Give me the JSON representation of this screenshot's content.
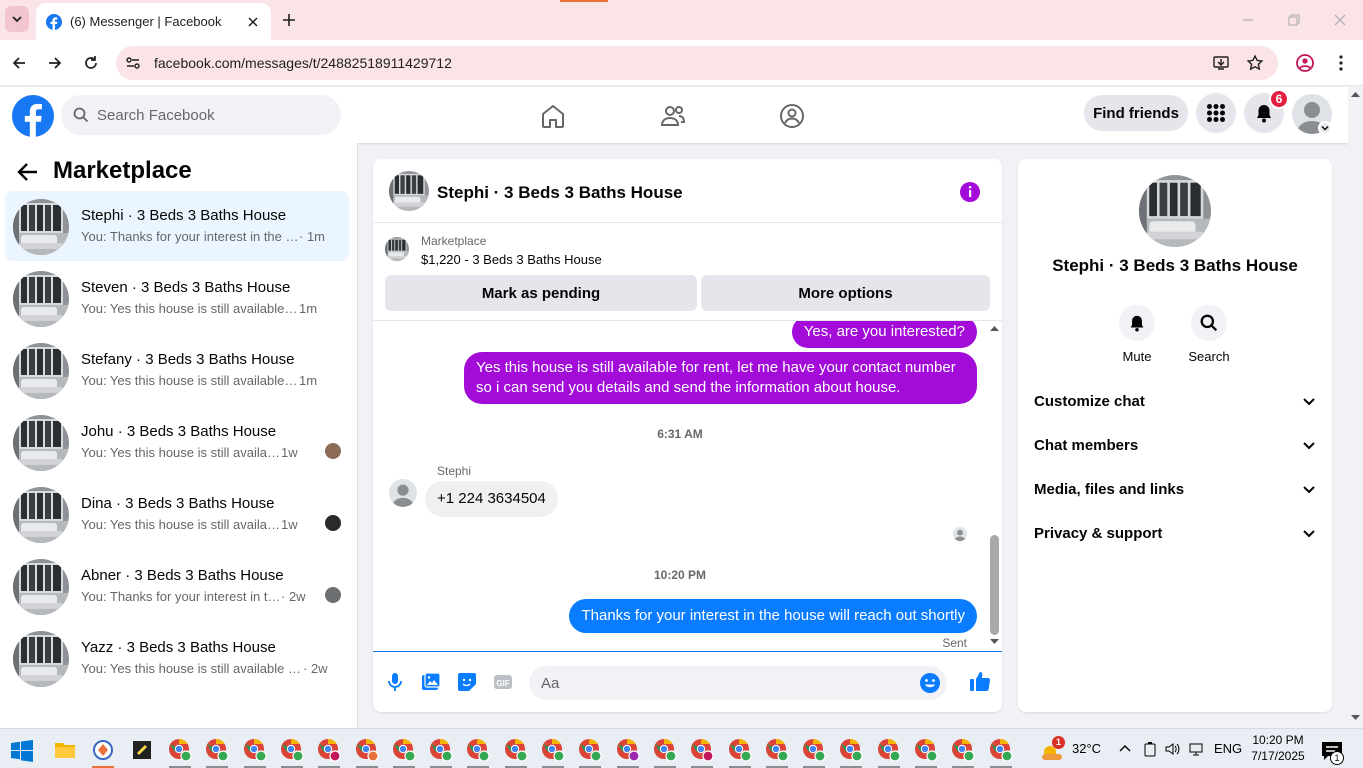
{
  "browser": {
    "tab_title": "(6) Messenger | Facebook",
    "url": "facebook.com/messages/t/24882518911429712"
  },
  "header": {
    "search_placeholder": "Search Facebook",
    "find_friends": "Find friends",
    "notif_count": "6"
  },
  "left": {
    "title": "Marketplace",
    "conversations": [
      {
        "name": "Stephi · 3 Beds 3 Baths House",
        "preview": "You: Thanks for your interest in the h...",
        "time": " · 1m",
        "active": true
      },
      {
        "name": "Steven · 3 Beds 3 Baths House",
        "preview": "You: Yes this house is still available fo...",
        "time": " 1m"
      },
      {
        "name": "Stefany · 3 Beds 3 Baths House",
        "preview": "You: Yes this house is still available fo...",
        "time": " 1m"
      },
      {
        "name": "Johu · 3 Beds 3 Baths House",
        "preview": "You: Yes this house is still available ...",
        "time": " 1w"
      },
      {
        "name": "Dina · 3 Beds 3 Baths House",
        "preview": "You: Yes this house is still available ...",
        "time": " 1w"
      },
      {
        "name": "Abner · 3 Beds 3 Baths House",
        "preview": "You: Thanks for your interest in the...",
        "time": " · 2w"
      },
      {
        "name": "Yazz · 3 Beds 3 Baths House",
        "preview": "You: Yes this house is still available for...",
        "time": " · 2w"
      }
    ]
  },
  "chat": {
    "title": "Stephi · 3 Beds 3 Baths House",
    "listing_category": "Marketplace",
    "listing_desc": "$1,220 - 3 Beds 3 Baths House",
    "btn_pending": "Mark as pending",
    "btn_more": "More options",
    "msg1": "Yes, are you interested?",
    "msg2_line1": "Yes this house is still available for rent, let me have your contact number",
    "msg2_line2": "so i can send you details and send the information about house.",
    "time1": "6:31 AM",
    "sender": "Stephi",
    "msg3": "+1 224 3634504",
    "time2": "10:20 PM",
    "msg4": "Thanks for your interest in the house will reach out shortly",
    "sent": "Sent",
    "composer_placeholder": "Aa"
  },
  "right": {
    "name": "Stephi · 3 Beds 3 Baths House",
    "mute": "Mute",
    "search": "Search",
    "rows": [
      "Customize chat",
      "Chat members",
      "Media, files and links",
      "Privacy & support"
    ]
  },
  "taskbar": {
    "weather_badge": "1",
    "temp": "32°C",
    "lang": "ENG",
    "time": "10:20 PM",
    "date": "7/17/2025",
    "notif": "1"
  },
  "colors": {
    "fb_blue": "#1877f2",
    "bubble_purple": "#a20bd8",
    "bubble_blue": "#0a7cff",
    "badge_red": "#e41e3f"
  }
}
